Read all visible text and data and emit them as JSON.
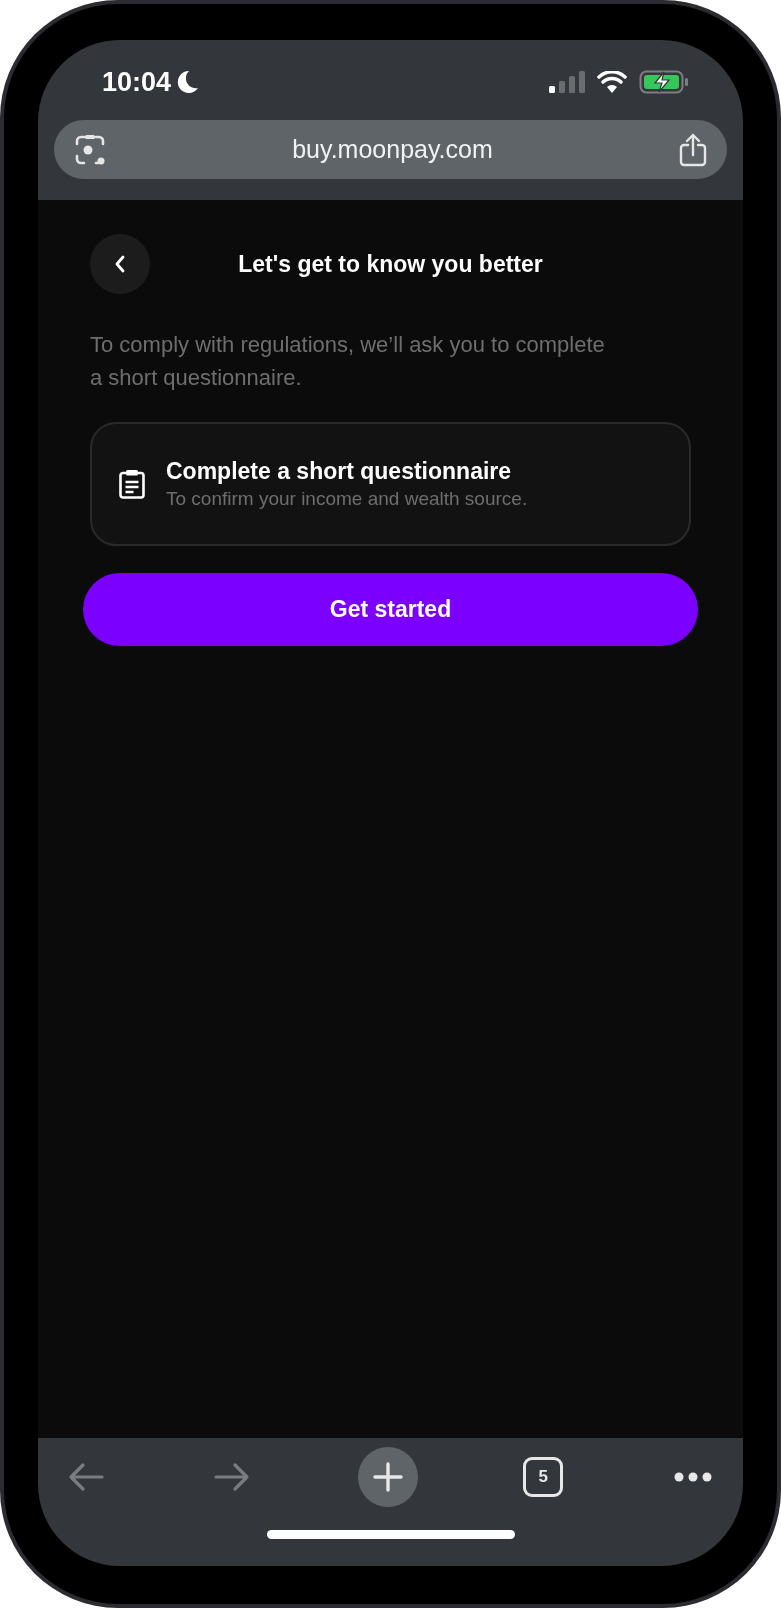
{
  "status_bar": {
    "time": "10:04"
  },
  "address_bar": {
    "url": "buy.moonpay.com"
  },
  "header": {
    "title": "Let's get to know you better"
  },
  "intro": "To comply with regulations, we’ll ask you to complete a short questionnaire.",
  "task_card": {
    "title": "Complete a short questionnaire",
    "subtitle": "To confirm your income and wealth source."
  },
  "primary_button": {
    "label": "Get started"
  },
  "toolbar": [
    {
      "kind": "back",
      "disabled": true
    },
    {
      "kind": "forward",
      "disabled": true
    },
    {
      "kind": "new-tab",
      "disabled": false
    },
    {
      "kind": "tabs",
      "label": "5",
      "disabled": false
    },
    {
      "kind": "more",
      "disabled": false
    }
  ]
}
